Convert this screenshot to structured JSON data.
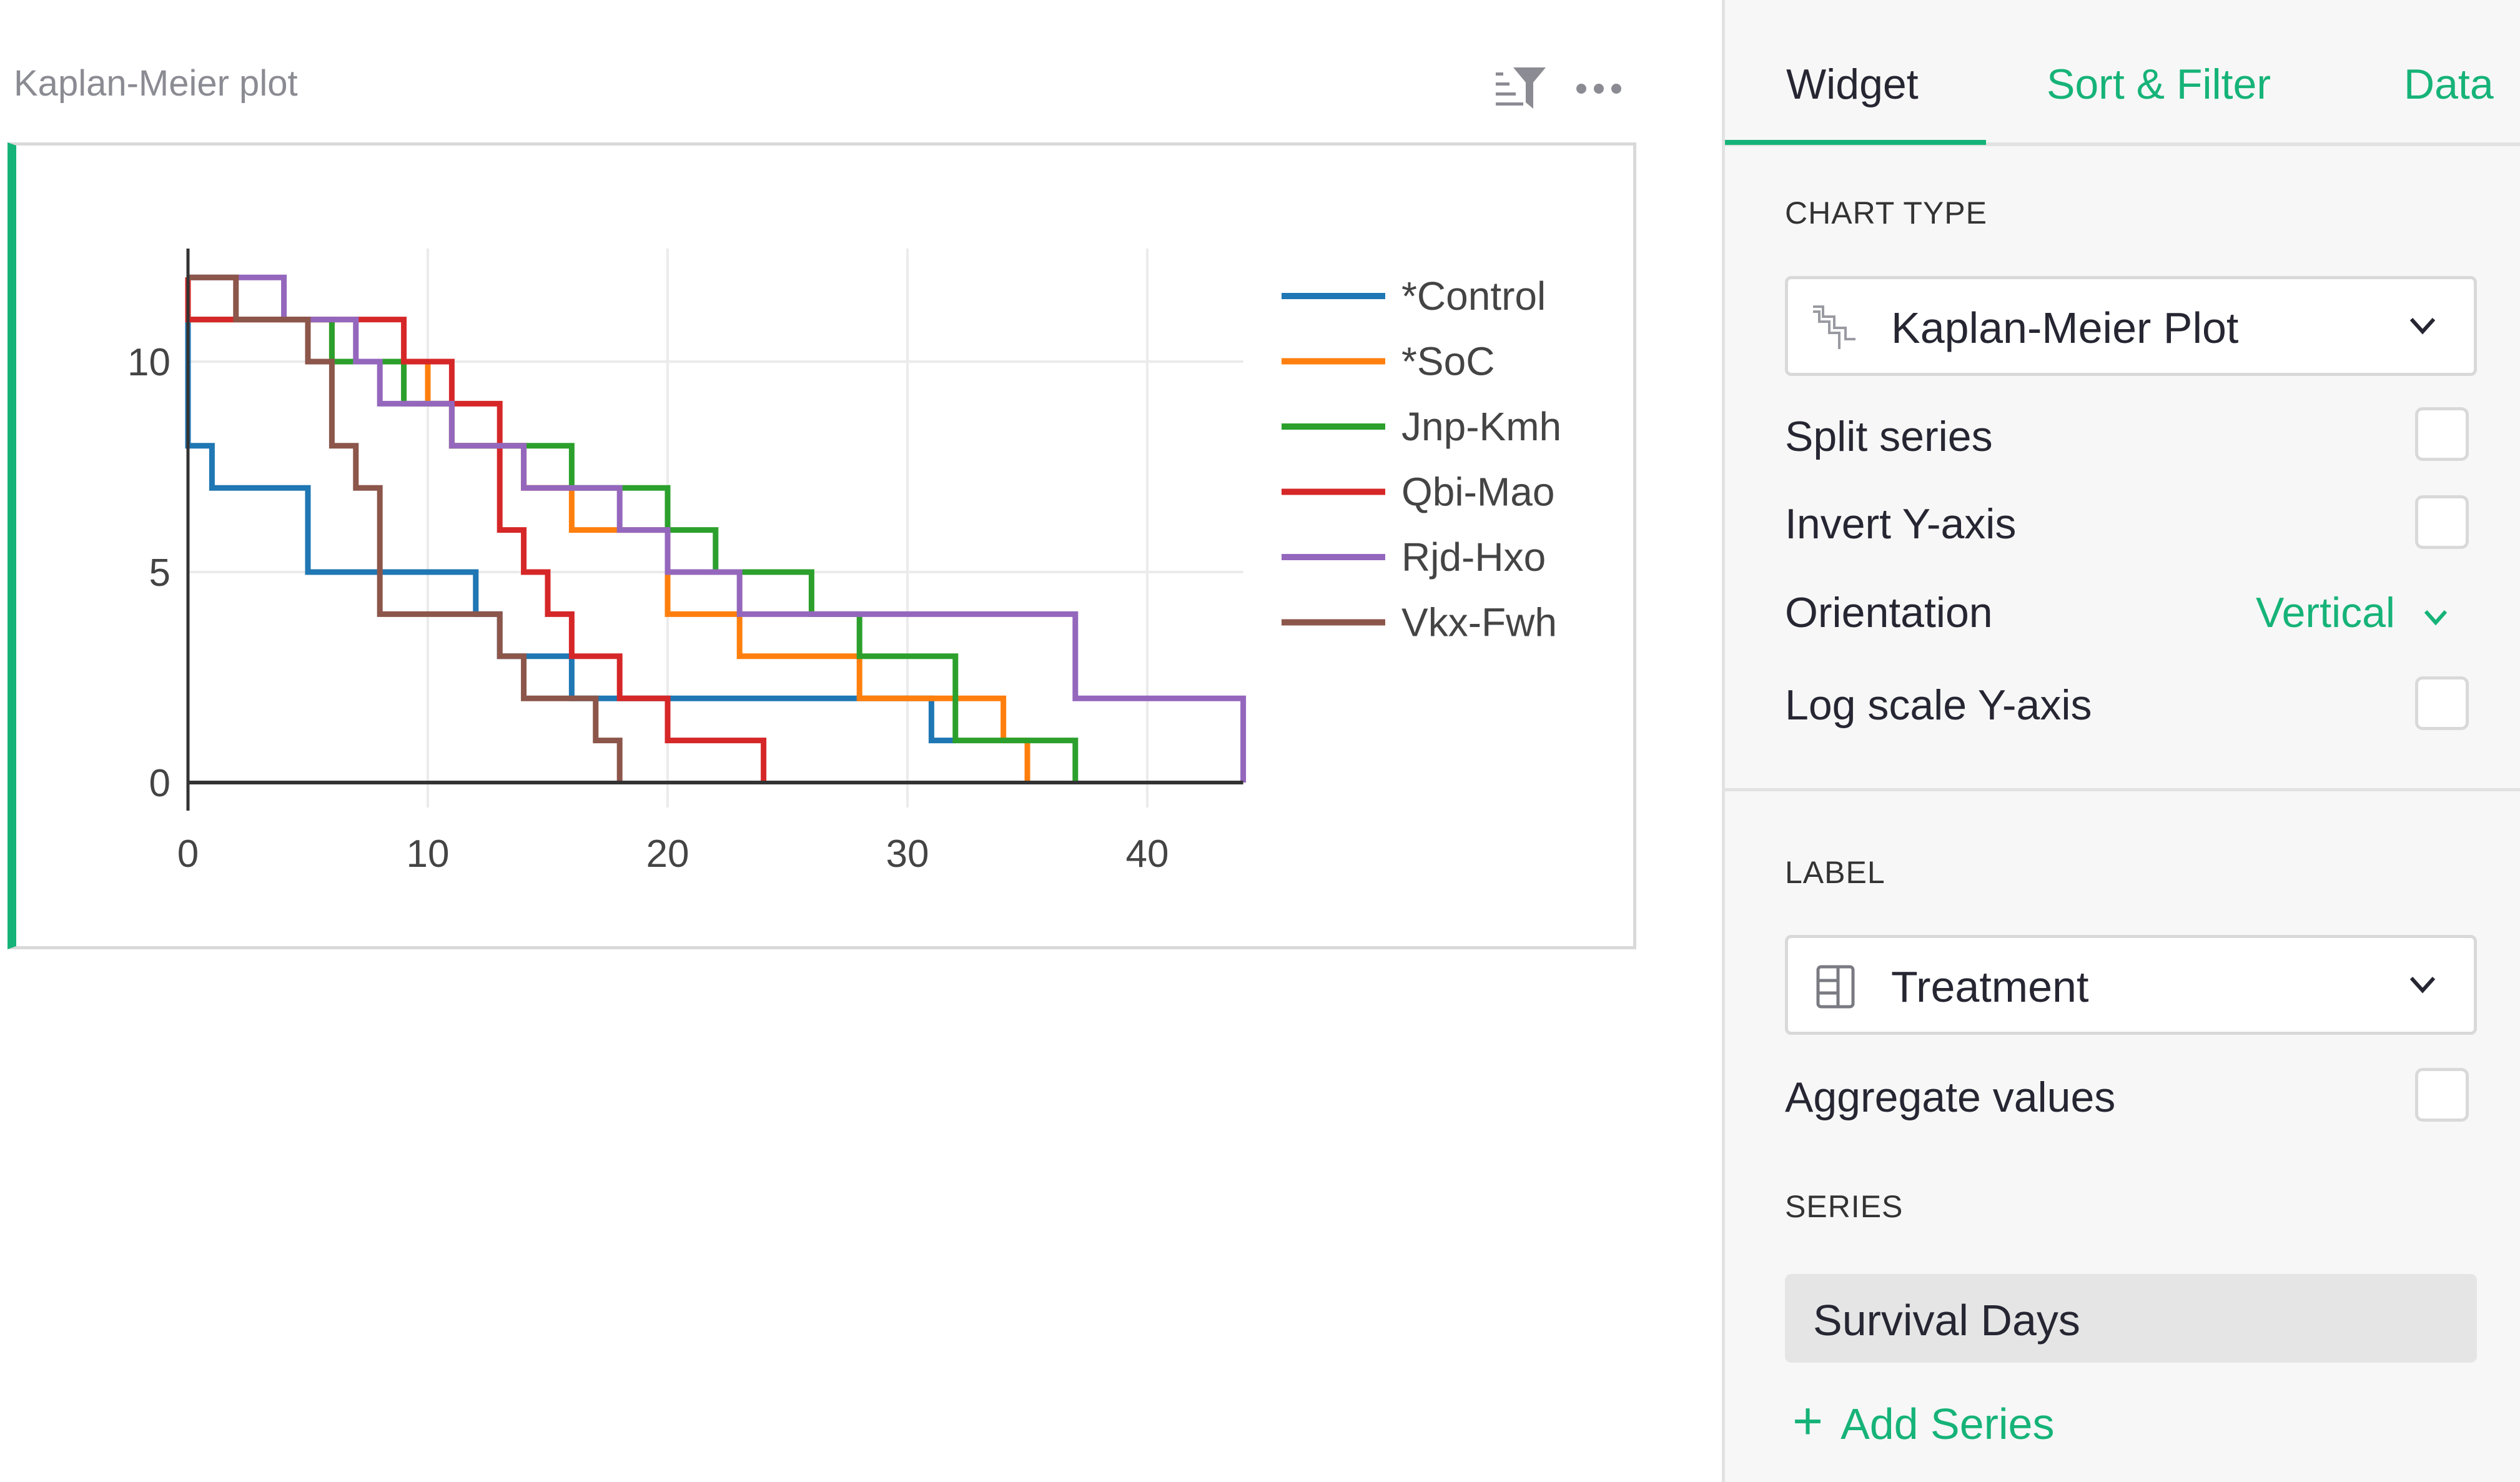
{
  "widget": {
    "title": "Kaplan-Meier plot",
    "icons": {
      "sort_filter": "sort-filter-icon",
      "more": "more-options-icon"
    }
  },
  "colors": {
    "accent": "#16b378",
    "series": [
      "#1f77b4",
      "#ff7f0e",
      "#2ca02c",
      "#d62728",
      "#9467bd",
      "#8c564b"
    ]
  },
  "chart_data": {
    "type": "line",
    "subtype": "kaplan-meier-step",
    "title": "",
    "xlabel": "",
    "ylabel": "",
    "xlim": [
      0,
      44
    ],
    "ylim": [
      0,
      12
    ],
    "x_ticks": [
      0,
      10,
      20,
      30,
      40
    ],
    "y_ticks": [
      0,
      5,
      10
    ],
    "grid": true,
    "legend_position": "right",
    "series": [
      {
        "name": "*Control",
        "color": "#1f77b4",
        "steps": [
          [
            0,
            11
          ],
          [
            0,
            8
          ],
          [
            1,
            7
          ],
          [
            5,
            5
          ],
          [
            12,
            4
          ],
          [
            13,
            3
          ],
          [
            16,
            2
          ],
          [
            31,
            1
          ],
          [
            32,
            1
          ]
        ]
      },
      {
        "name": "*SoC",
        "color": "#ff7f0e",
        "steps": [
          [
            0,
            12
          ],
          [
            0,
            11
          ],
          [
            6,
            10
          ],
          [
            10,
            9
          ],
          [
            11,
            8
          ],
          [
            14,
            7
          ],
          [
            16,
            6
          ],
          [
            20,
            4
          ],
          [
            23,
            3
          ],
          [
            28,
            2
          ],
          [
            34,
            1
          ],
          [
            35,
            0
          ]
        ]
      },
      {
        "name": "Jnp-Kmh",
        "color": "#2ca02c",
        "steps": [
          [
            0,
            12
          ],
          [
            0,
            11
          ],
          [
            6,
            10
          ],
          [
            9,
            9
          ],
          [
            11,
            8
          ],
          [
            16,
            7
          ],
          [
            20,
            6
          ],
          [
            22,
            5
          ],
          [
            26,
            4
          ],
          [
            28,
            3
          ],
          [
            32,
            1
          ],
          [
            37,
            0
          ]
        ]
      },
      {
        "name": "Qbi-Mao",
        "color": "#d62728",
        "steps": [
          [
            0,
            12
          ],
          [
            0,
            11
          ],
          [
            9,
            10
          ],
          [
            11,
            9
          ],
          [
            13,
            6
          ],
          [
            14,
            5
          ],
          [
            15,
            4
          ],
          [
            16,
            3
          ],
          [
            18,
            2
          ],
          [
            20,
            1
          ],
          [
            24,
            0
          ]
        ]
      },
      {
        "name": "Rjd-Hxo",
        "color": "#9467bd",
        "steps": [
          [
            0,
            12
          ],
          [
            4,
            11
          ],
          [
            7,
            10
          ],
          [
            8,
            9
          ],
          [
            11,
            8
          ],
          [
            14,
            7
          ],
          [
            18,
            6
          ],
          [
            20,
            5
          ],
          [
            23,
            4
          ],
          [
            37,
            2
          ],
          [
            44,
            0
          ]
        ]
      },
      {
        "name": "Vkx-Fwh",
        "color": "#8c564b",
        "steps": [
          [
            0,
            12
          ],
          [
            2,
            11
          ],
          [
            5,
            10
          ],
          [
            6,
            8
          ],
          [
            7,
            7
          ],
          [
            8,
            4
          ],
          [
            13,
            3
          ],
          [
            14,
            2
          ],
          [
            17,
            1
          ],
          [
            18,
            0
          ]
        ]
      }
    ]
  },
  "panel": {
    "tabs": [
      {
        "label": "Widget",
        "active": true
      },
      {
        "label": "Sort & Filter",
        "active": false
      },
      {
        "label": "Data",
        "active": false
      }
    ],
    "chart_type": {
      "section_label": "CHART TYPE",
      "value": "Kaplan-Meier Plot",
      "icon": "kaplan-meier-chart-icon"
    },
    "options": {
      "split_series": {
        "label": "Split series",
        "checked": false
      },
      "invert_y": {
        "label": "Invert Y-axis",
        "checked": false
      },
      "orientation": {
        "label": "Orientation",
        "value": "Vertical"
      },
      "log_scale_y": {
        "label": "Log scale Y-axis",
        "checked": false
      }
    },
    "label_section": {
      "section_label": "LABEL",
      "value": "Treatment",
      "icon": "column-icon",
      "aggregate": {
        "label": "Aggregate values",
        "checked": false
      }
    },
    "series_section": {
      "section_label": "SERIES",
      "items": [
        "Survival Days"
      ],
      "add_label": "Add Series"
    }
  }
}
